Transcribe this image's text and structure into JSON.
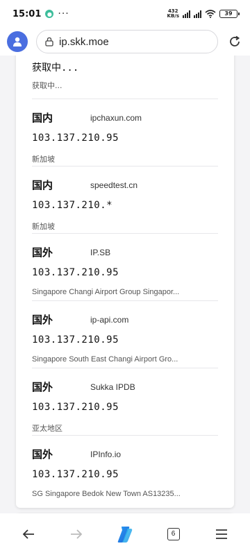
{
  "status_bar": {
    "time": "15:01",
    "more": "···",
    "speed_value": "432",
    "speed_unit": "KB/s",
    "battery": "39"
  },
  "browser": {
    "url": "ip.skk.moe"
  },
  "first_entry": {
    "ip": "获取中...",
    "location": "获取中..."
  },
  "entries": [
    {
      "region": "国内",
      "source": "ipchaxun.com",
      "ip": "103.137.210.95",
      "location": "新加坡"
    },
    {
      "region": "国内",
      "source": "speedtest.cn",
      "ip": "103.137.210.*",
      "location": "新加坡"
    },
    {
      "region": "国外",
      "source": "IP.SB",
      "ip": "103.137.210.95",
      "location": "Singapore Changi Airport Group Singapor..."
    },
    {
      "region": "国外",
      "source": "ip-api.com",
      "ip": "103.137.210.95",
      "location": "Singapore South East Changi Airport Gro..."
    },
    {
      "region": "国外",
      "source": "Sukka IPDB",
      "ip": "103.137.210.95",
      "location": "亚太地区"
    },
    {
      "region": "国外",
      "source": "IPInfo.io",
      "ip": "103.137.210.95",
      "location": "SG Singapore Bedok New Town AS13235..."
    }
  ],
  "bottom_nav": {
    "tab_count": "6"
  },
  "colors": {
    "avatar": "#4a6ee0",
    "app_dot": "#3dbd9b",
    "divider": "#e7e7ea"
  }
}
